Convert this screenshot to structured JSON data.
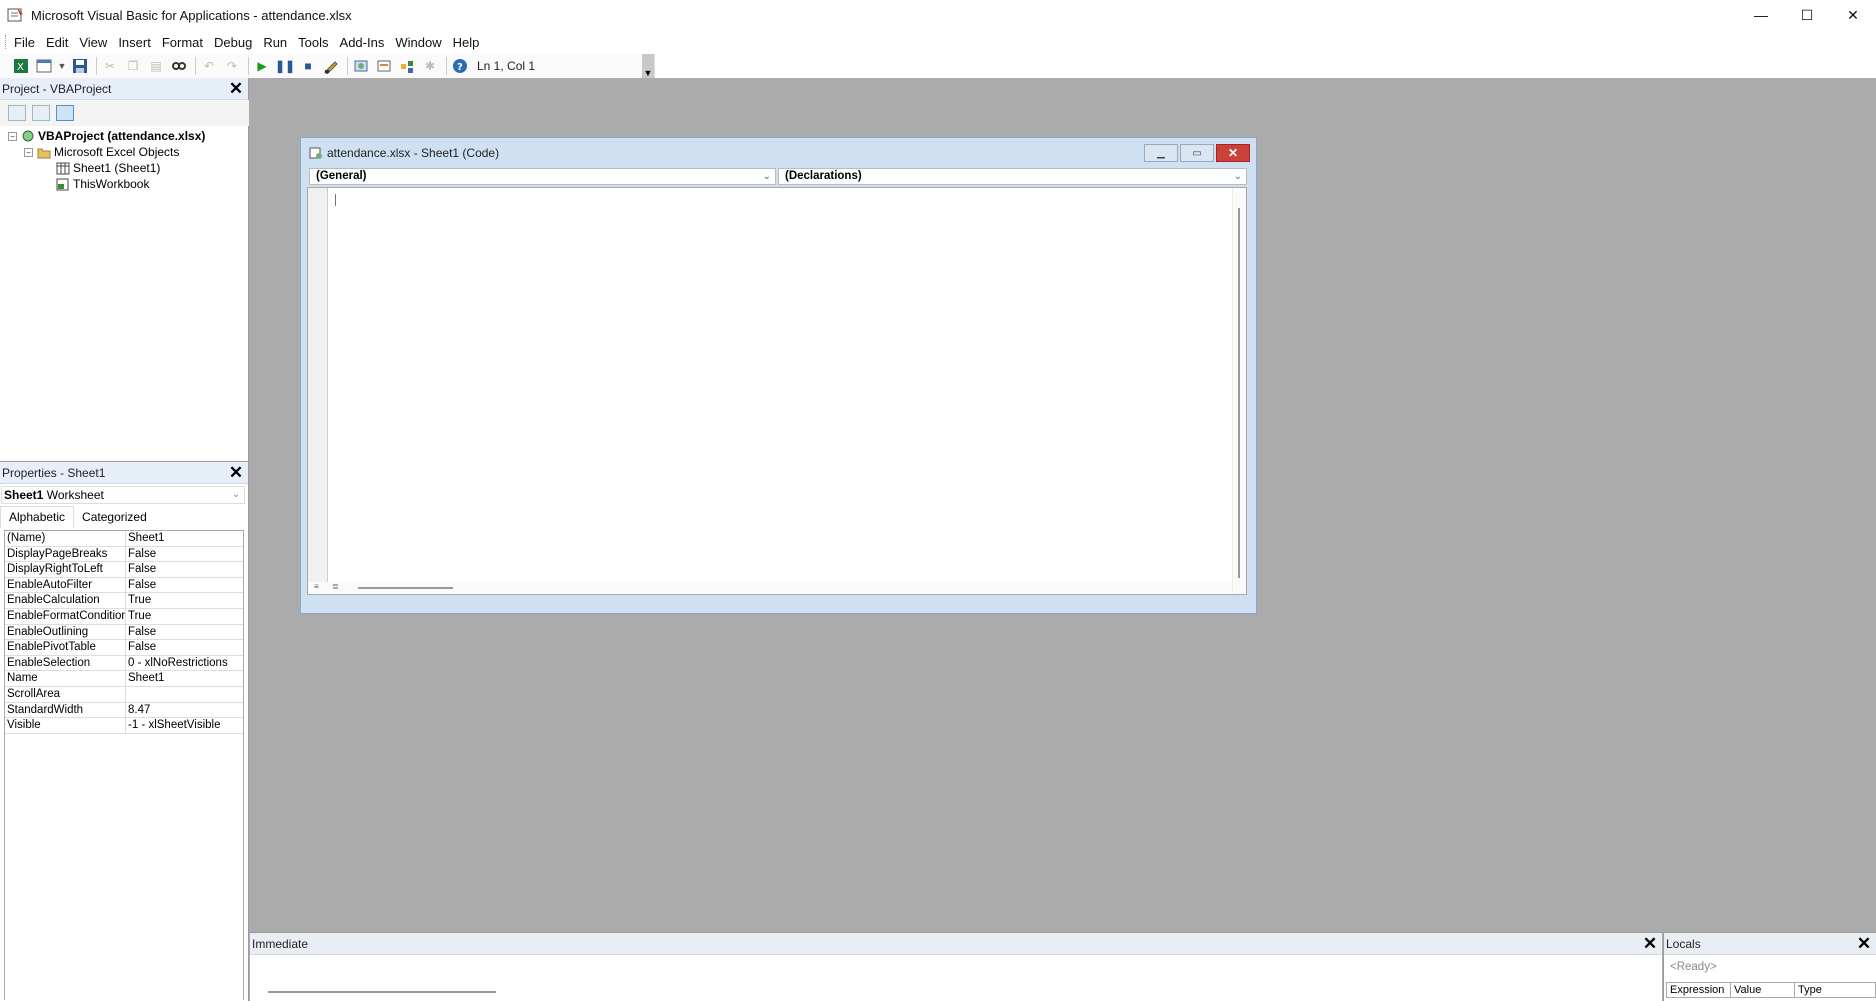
{
  "window": {
    "title": "Microsoft Visual Basic for Applications - attendance.xlsx",
    "controls": {
      "minimize": "—",
      "maximize": "☐",
      "close": "✕"
    }
  },
  "menu": [
    "File",
    "Edit",
    "View",
    "Insert",
    "Format",
    "Debug",
    "Run",
    "Tools",
    "Add-Ins",
    "Window",
    "Help"
  ],
  "toolbar": {
    "position": "Ln 1, Col 1",
    "icons": [
      "excel-icon",
      "insert-module-icon",
      "save-icon",
      "cut-icon",
      "copy-icon",
      "paste-icon",
      "find-icon",
      "undo-icon",
      "redo-icon",
      "run-icon",
      "break-icon",
      "reset-icon",
      "design-mode-icon",
      "project-explorer-icon",
      "properties-window-icon",
      "object-browser-icon",
      "toolbox-icon",
      "help-icon"
    ]
  },
  "project": {
    "header": "Project - VBAProject",
    "tree": {
      "root": "VBAProject (attendance.xlsx)",
      "folder": "Microsoft Excel Objects",
      "items": [
        "Sheet1 (Sheet1)",
        "ThisWorkbook"
      ]
    }
  },
  "properties": {
    "header": "Properties - Sheet1",
    "object_name": "Sheet1",
    "object_type": "Worksheet",
    "tabs": [
      "Alphabetic",
      "Categorized"
    ],
    "rows": [
      {
        "key": "(Name)",
        "value": "Sheet1"
      },
      {
        "key": "DisplayPageBreaks",
        "value": "False"
      },
      {
        "key": "DisplayRightToLeft",
        "value": "False"
      },
      {
        "key": "EnableAutoFilter",
        "value": "False"
      },
      {
        "key": "EnableCalculation",
        "value": "True"
      },
      {
        "key": "EnableFormatConditionsCalculation",
        "value": "True"
      },
      {
        "key": "EnableOutlining",
        "value": "False"
      },
      {
        "key": "EnablePivotTable",
        "value": "False"
      },
      {
        "key": "EnableSelection",
        "value": "0 - xlNoRestrictions"
      },
      {
        "key": "Name",
        "value": "Sheet1"
      },
      {
        "key": "ScrollArea",
        "value": ""
      },
      {
        "key": "StandardWidth",
        "value": "8.47"
      },
      {
        "key": "Visible",
        "value": "-1 - xlSheetVisible"
      }
    ]
  },
  "code_window": {
    "title": "attendance.xlsx - Sheet1 (Code)",
    "object_combo": "(General)",
    "procedure_combo": "(Declarations)"
  },
  "immediate": {
    "header": "Immediate"
  },
  "locals": {
    "header": "Locals",
    "status": "<Ready>",
    "columns": [
      "Expression",
      "Value",
      "Type"
    ]
  }
}
